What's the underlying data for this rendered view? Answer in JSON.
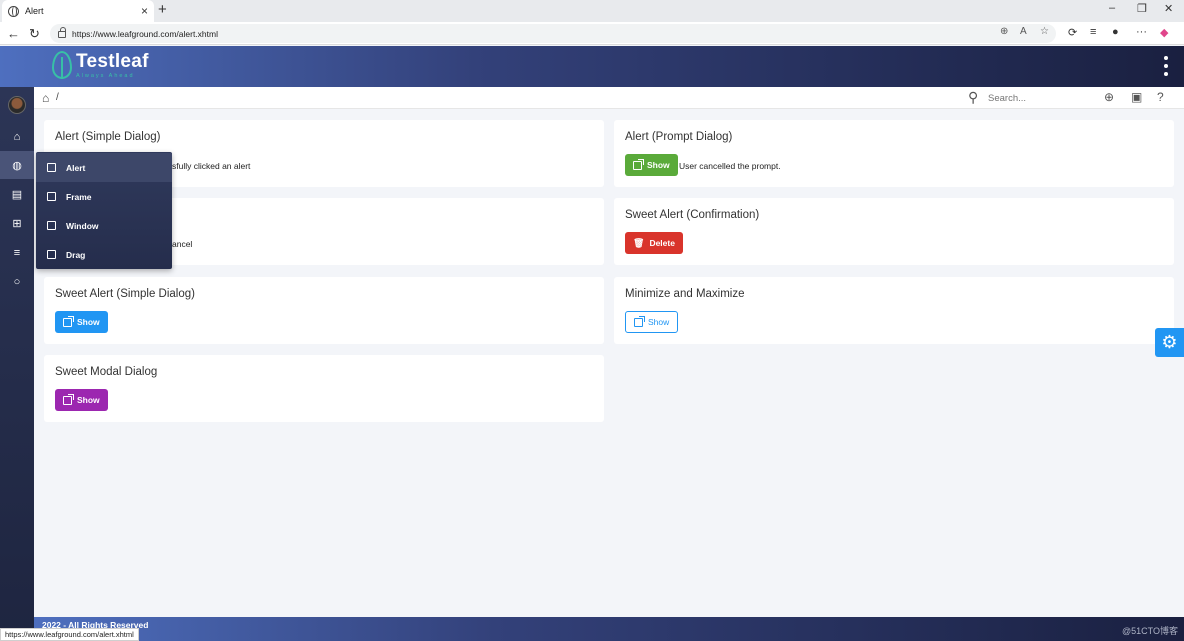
{
  "browser": {
    "tab_title": "Alert",
    "url": "https://www.leafground.com/alert.xhtml",
    "new_tab": "+",
    "tab_close": "×"
  },
  "app": {
    "logo_text": "Testleaf",
    "logo_tagline": "Always Ahead"
  },
  "breadcrumb": {
    "separator": "/"
  },
  "search": {
    "placeholder": "Search..."
  },
  "flyout": {
    "items": [
      {
        "label": "Alert"
      },
      {
        "label": "Frame"
      },
      {
        "label": "Window"
      },
      {
        "label": "Drag"
      }
    ]
  },
  "cards": {
    "simple_alert": {
      "title": "Alert (Simple Dialog)",
      "message": "sfully clicked an alert"
    },
    "prompt_alert": {
      "title": "Alert (Prompt Dialog)",
      "button": "Show",
      "message": "User cancelled the prompt."
    },
    "confirm_alert": {
      "message": "ancel"
    },
    "sweet_confirm": {
      "title": "Sweet Alert (Confirmation)",
      "button": "Delete"
    },
    "sweet_simple": {
      "title": "Sweet Alert (Simple Dialog)",
      "button": "Show"
    },
    "min_max": {
      "title": "Minimize and Maximize",
      "button": "Show"
    },
    "sweet_modal": {
      "title": "Sweet Modal Dialog",
      "button": "Show"
    }
  },
  "footer": {
    "text": "2022 - All Rights Reserved"
  },
  "status_bar": {
    "url": "https://www.leafground.com/alert.xhtml"
  },
  "watermark": "@51CTO博客",
  "colors": {
    "green": "#5aaa3a",
    "red": "#d9342b",
    "blue": "#2196f3",
    "purple": "#9c27b0",
    "brand_teal": "#38c0a6"
  }
}
